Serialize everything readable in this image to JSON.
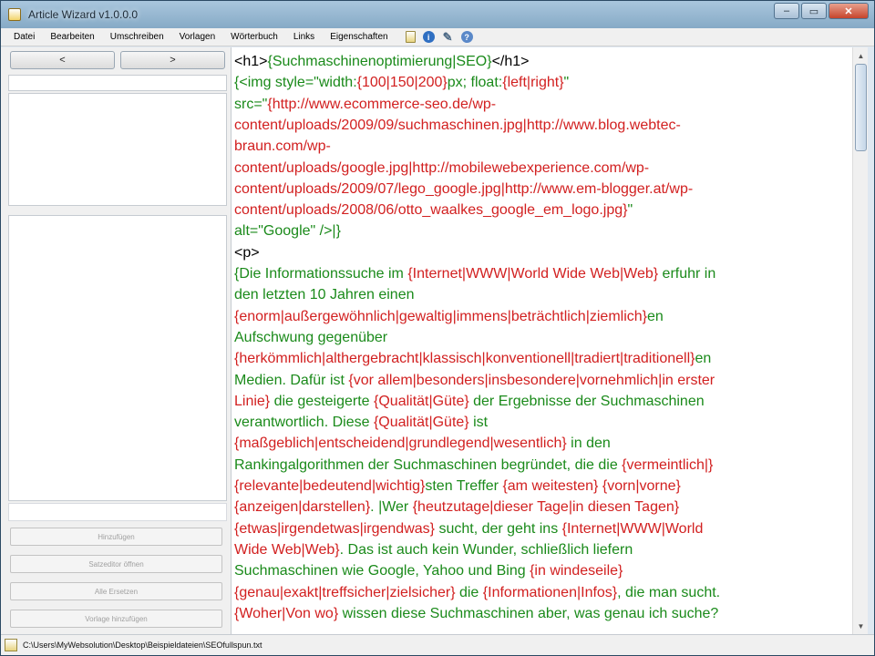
{
  "window": {
    "title": "Article Wizard v1.0.0.0"
  },
  "menu": {
    "items": [
      "Datei",
      "Bearbeiten",
      "Umschreiben",
      "Vorlagen",
      "Wörterbuch",
      "Links",
      "Eigenschaften"
    ],
    "icons": [
      "document-icon",
      "info-icon",
      "tools-icon",
      "help-icon"
    ]
  },
  "left": {
    "nav_prev": "<",
    "nav_next": ">",
    "buttons": [
      "Hinzufügen",
      "Satzeditor öffnen",
      "Alle Ersetzen",
      "Vorlage hinzufügen"
    ]
  },
  "editor": {
    "lines": [
      [
        [
          "k",
          "<h1>"
        ],
        [
          "g",
          "{Suchmaschinenoptimierung|SEO}"
        ],
        [
          "k",
          "</h1>"
        ]
      ],
      [
        [
          "g",
          "{<img style=\"width:"
        ],
        [
          "r",
          "{100|150|200}"
        ],
        [
          "g",
          "px; float:"
        ],
        [
          "r",
          "{left|right}"
        ],
        [
          "g",
          "\""
        ]
      ],
      [
        [
          "g",
          "src=\""
        ],
        [
          "r",
          "{http://www.ecommerce-seo.de/wp-"
        ]
      ],
      [
        [
          "r",
          "content/uploads/2009/09/suchmaschinen.jpg|http://www.blog.webtec-"
        ]
      ],
      [
        [
          "r",
          "braun.com/wp-"
        ]
      ],
      [
        [
          "r",
          "content/uploads/google.jpg|http://mobilewebexperience.com/wp-"
        ]
      ],
      [
        [
          "r",
          "content/uploads/2009/07/lego_google.jpg|http://www.em-blogger.at/wp-"
        ]
      ],
      [
        [
          "r",
          "content/uploads/2008/06/otto_waalkes_google_em_logo.jpg}"
        ],
        [
          "g",
          "\""
        ]
      ],
      [
        [
          "g",
          "alt=\"Google\" />|}"
        ]
      ],
      [
        [
          "k",
          "<p>"
        ]
      ],
      [
        [
          "g",
          "{Die Informationssuche im "
        ],
        [
          "r",
          "{Internet|WWW|World Wide Web|Web}"
        ],
        [
          "g",
          " erfuhr in"
        ]
      ],
      [
        [
          "g",
          "den letzten 10 Jahren einen"
        ]
      ],
      [
        [
          "r",
          "{enorm|außergewöhnlich|gewaltig|immens|beträchtlich|ziemlich}"
        ],
        [
          "g",
          "en"
        ]
      ],
      [
        [
          "g",
          "Aufschwung gegenüber"
        ]
      ],
      [
        [
          "r",
          "{herkömmlich|althergebracht|klassisch|konventionell|tradiert|traditionell}"
        ],
        [
          "g",
          "en"
        ]
      ],
      [
        [
          "g",
          "Medien. Dafür ist "
        ],
        [
          "r",
          "{vor allem|besonders|insbesondere|vornehmlich|in erster"
        ]
      ],
      [
        [
          "r",
          "Linie}"
        ],
        [
          "g",
          " die gesteigerte "
        ],
        [
          "r",
          "{Qualität|Güte}"
        ],
        [
          "g",
          " der Ergebnisse der Suchmaschinen"
        ]
      ],
      [
        [
          "g",
          "verantwortlich. Diese "
        ],
        [
          "r",
          "{Qualität|Güte}"
        ],
        [
          "g",
          " ist"
        ]
      ],
      [
        [
          "r",
          "{maßgeblich|entscheidend|grundlegend|wesentlich}"
        ],
        [
          "g",
          " in den"
        ]
      ],
      [
        [
          "g",
          "Rankingalgorithmen der Suchmaschinen begründet, die die "
        ],
        [
          "r",
          "{vermeintlich|}"
        ]
      ],
      [
        [
          "r",
          "{relevante|bedeutend|wichtig}"
        ],
        [
          "g",
          "sten Treffer "
        ],
        [
          "r",
          "{am weitesten}"
        ],
        [
          "g",
          " "
        ],
        [
          "r",
          "{vorn|vorne}"
        ]
      ],
      [
        [
          "r",
          "{anzeigen|darstellen}"
        ],
        [
          "g",
          ". |Wer "
        ],
        [
          "r",
          "{heutzutage|dieser Tage|in diesen Tagen}"
        ]
      ],
      [
        [
          "r",
          "{etwas|irgendetwas|irgendwas}"
        ],
        [
          "g",
          " sucht, der geht ins "
        ],
        [
          "r",
          "{Internet|WWW|World"
        ]
      ],
      [
        [
          "r",
          "Wide Web|Web}"
        ],
        [
          "g",
          ". Das ist auch kein Wunder, schließlich liefern"
        ]
      ],
      [
        [
          "g",
          "Suchmaschinen wie Google, Yahoo und Bing "
        ],
        [
          "r",
          "{in windeseile}"
        ]
      ],
      [
        [
          "r",
          "{genau|exakt|treffsicher|zielsicher}"
        ],
        [
          "g",
          " die "
        ],
        [
          "r",
          "{Informationen|Infos}"
        ],
        [
          "g",
          ", die man sucht."
        ]
      ],
      [
        [
          "r",
          "{Woher|Von wo}"
        ],
        [
          "g",
          " wissen diese Suchmaschinen aber, was genau ich suche?"
        ]
      ]
    ]
  },
  "status": {
    "path": "C:\\Users\\MyWebsolution\\Desktop\\Beispieldateien\\SEOfullspun.txt"
  },
  "colors": {
    "spin_red": "#d22020",
    "text_green": "#1a8a1a",
    "tag_black": "#000000"
  }
}
